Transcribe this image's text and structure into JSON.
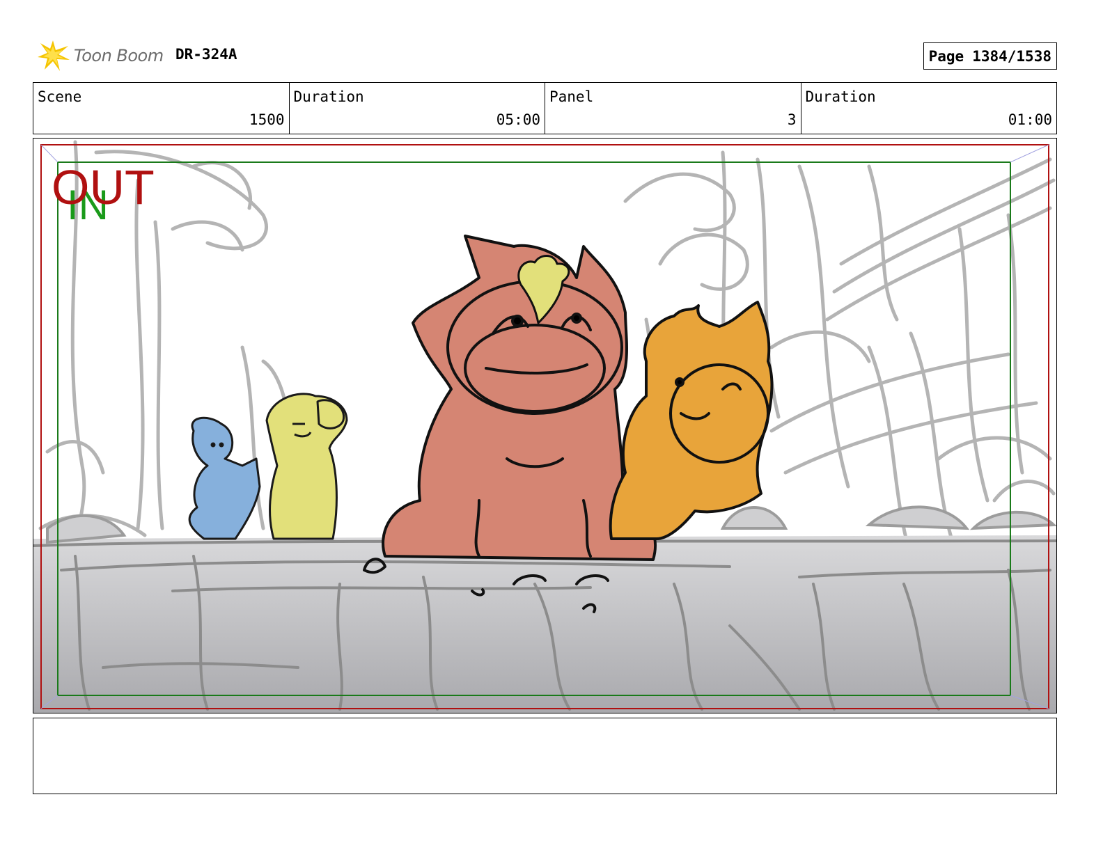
{
  "header": {
    "logo_text": "Toon Boom",
    "project_code": "DR-324A",
    "page_label": "Page",
    "page_value": "1384/1538"
  },
  "info": [
    {
      "label": "Scene",
      "value": "1500"
    },
    {
      "label": "Duration",
      "value": "05:00"
    },
    {
      "label": "Panel",
      "value": "3"
    },
    {
      "label": "Duration",
      "value": "01:00"
    }
  ],
  "frame": {
    "out_label": "OUT",
    "in_label": "IN"
  },
  "colors": {
    "out_color": "#b01010",
    "in_color": "#1a9a1a",
    "pig_fill": "#d58573",
    "cat_fill": "#e8a43a",
    "yellow_fill": "#e2e07a",
    "blue_fill": "#86b0dc"
  },
  "notes": {
    "text": ""
  }
}
